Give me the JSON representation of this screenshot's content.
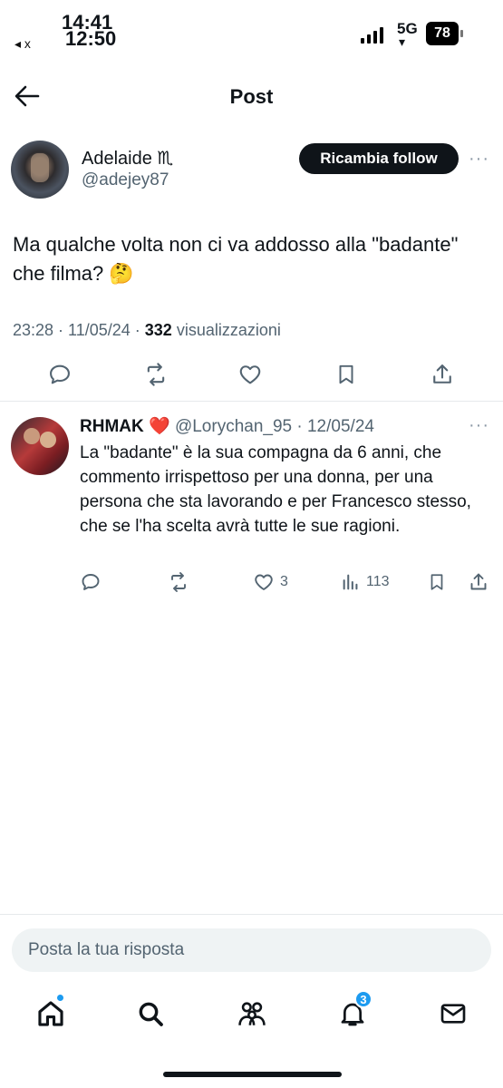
{
  "status_bar": {
    "time_top": "14:41",
    "time_bottom": "12:50",
    "back_app": "◂ x",
    "network": "5G",
    "battery": "78"
  },
  "header": {
    "title": "Post"
  },
  "post": {
    "author_name": "Adelaide ♏",
    "author_handle": "@adejey87",
    "follow_label": "Ricambia follow",
    "text": "Ma qualche volta non ci va addosso alla \"badante\" che filma? 🤔",
    "timestamp": "23:28 · 11/05/24 · ",
    "views_count": "332",
    "views_label": " visualizzazioni"
  },
  "reply": {
    "name": "RHMAK",
    "heart": "❤️",
    "handle_date": "@Lorychan_95 · 12/05/24",
    "text": "La \"badante\" è la sua compagna da 6 anni, che commento irrispettoso per una donna, per una persona che sta lavorando e per Francesco stesso, che se l'ha scelta avrà tutte le sue ragioni.",
    "likes": "3",
    "views": "113"
  },
  "compose": {
    "placeholder": "Posta la tua risposta"
  },
  "tabbar": {
    "notifications_badge": "3"
  },
  "icons": {
    "more": "···"
  }
}
